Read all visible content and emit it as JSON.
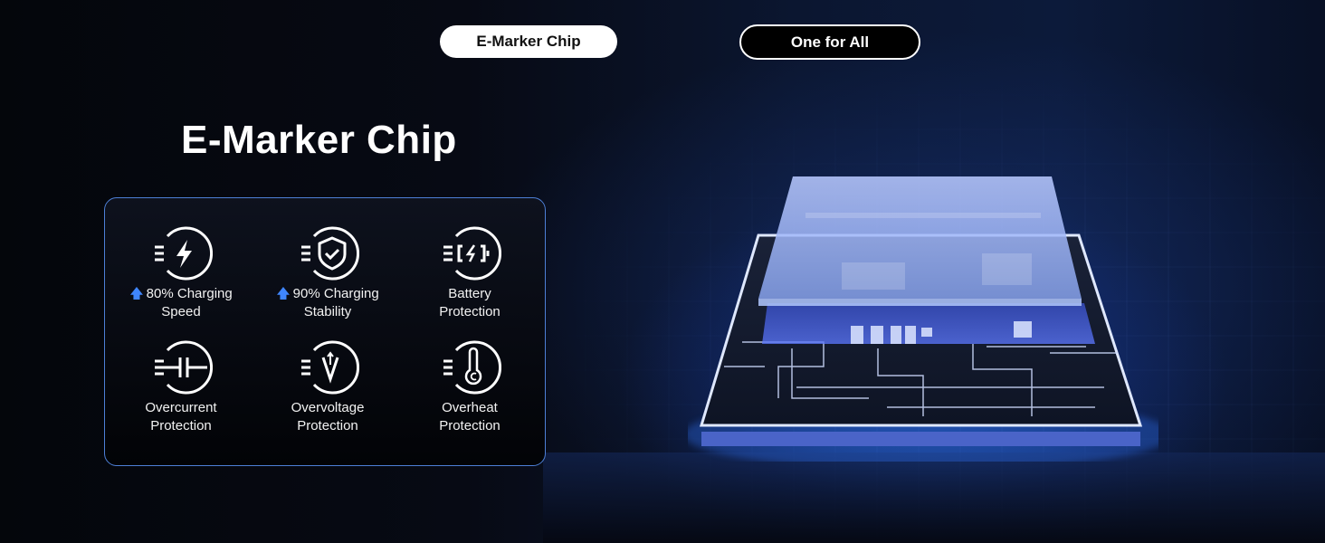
{
  "tabs": [
    {
      "label": "E-Marker Chip",
      "active": true
    },
    {
      "label": "One for All",
      "active": false
    }
  ],
  "title": "E-Marker Chip",
  "features": [
    {
      "icon": "lightning-icon",
      "highlight": "80% Charging",
      "line2": "Speed",
      "has_up_arrow": true
    },
    {
      "icon": "shield-check-icon",
      "highlight": "90% Charging",
      "line2": "Stability",
      "has_up_arrow": true
    },
    {
      "icon": "battery-icon",
      "highlight": "Battery",
      "line2": "Protection",
      "has_up_arrow": false
    },
    {
      "icon": "capacitor-icon",
      "highlight": "Overcurrent",
      "line2": "Protection",
      "has_up_arrow": false
    },
    {
      "icon": "voltage-icon",
      "highlight": "Overvoltage",
      "line2": "Protection",
      "has_up_arrow": false
    },
    {
      "icon": "thermometer-icon",
      "highlight": "Overheat",
      "line2": "Protection",
      "has_up_arrow": false
    }
  ],
  "colors": {
    "panel_border": "#4d7fd6",
    "arrow": "#3f86ff",
    "glow": "#2f6ff0"
  }
}
